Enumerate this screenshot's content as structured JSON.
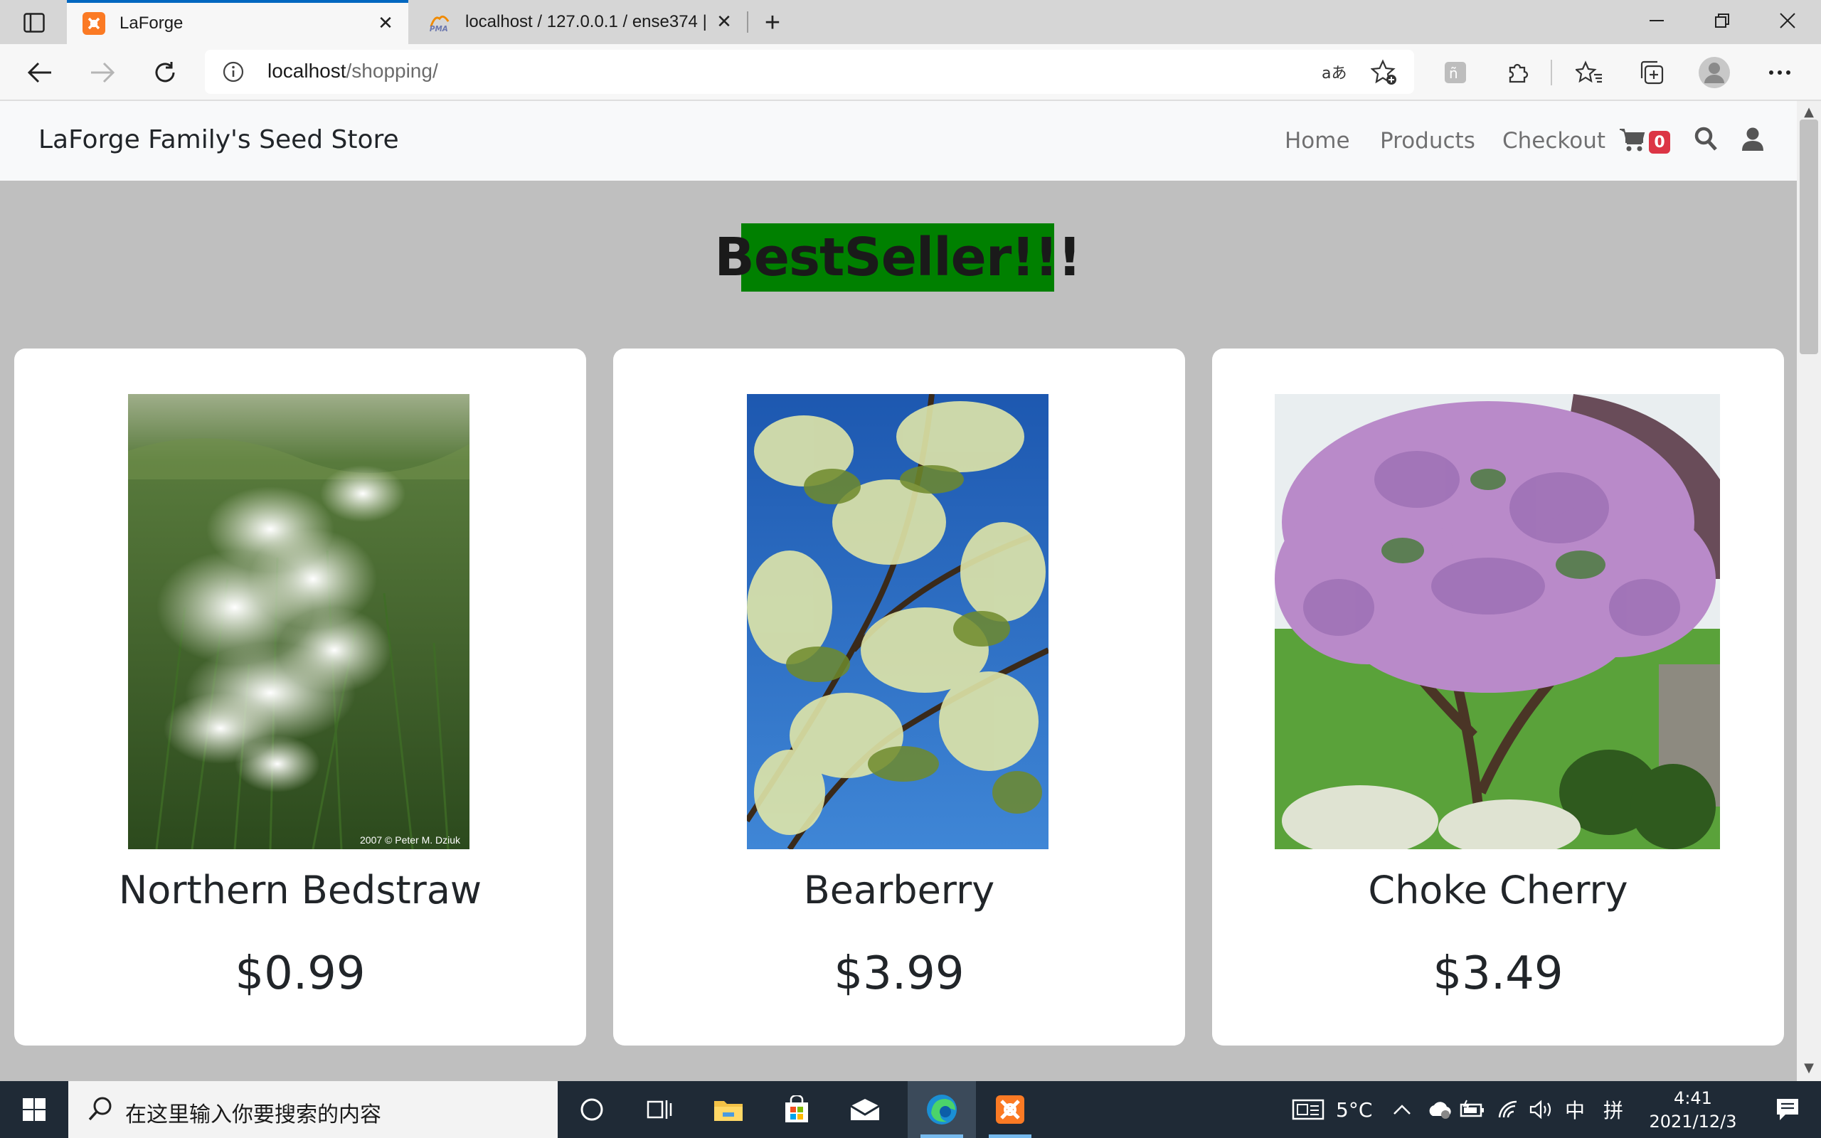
{
  "browser": {
    "tabs": [
      {
        "title": "LaForge",
        "active": true,
        "favicon": "xampp-icon"
      },
      {
        "title": "localhost / 127.0.0.1 / ense374 | p",
        "active": false,
        "favicon": "phpmyadmin-icon"
      }
    ],
    "url_host": "localhost",
    "url_path": "/shopping/"
  },
  "navbar": {
    "brand": "LaForge Family's Seed Store",
    "links": [
      "Home",
      "Products",
      "Checkout"
    ],
    "cart_count": "0"
  },
  "headline": "BestSeller!!!",
  "products": [
    {
      "name": "Northern Bedstraw",
      "price": "$0.99",
      "photo_credit": "2007 © Peter M. Dziuk"
    },
    {
      "name": "Bearberry",
      "price": "$3.99"
    },
    {
      "name": "Choke Cherry",
      "price": "$3.49"
    }
  ],
  "taskbar": {
    "search_placeholder": "在这里输入你要搜索的内容",
    "weather": "5°C",
    "ime_lang": "中",
    "ime_mode": "拼",
    "time": "4:41",
    "date": "2021/12/3"
  },
  "colors": {
    "headline_bg": "#008000",
    "cart_badge": "#dc3545",
    "page_bg": "#bfbfbf",
    "tab_accent": "#0067c0"
  }
}
